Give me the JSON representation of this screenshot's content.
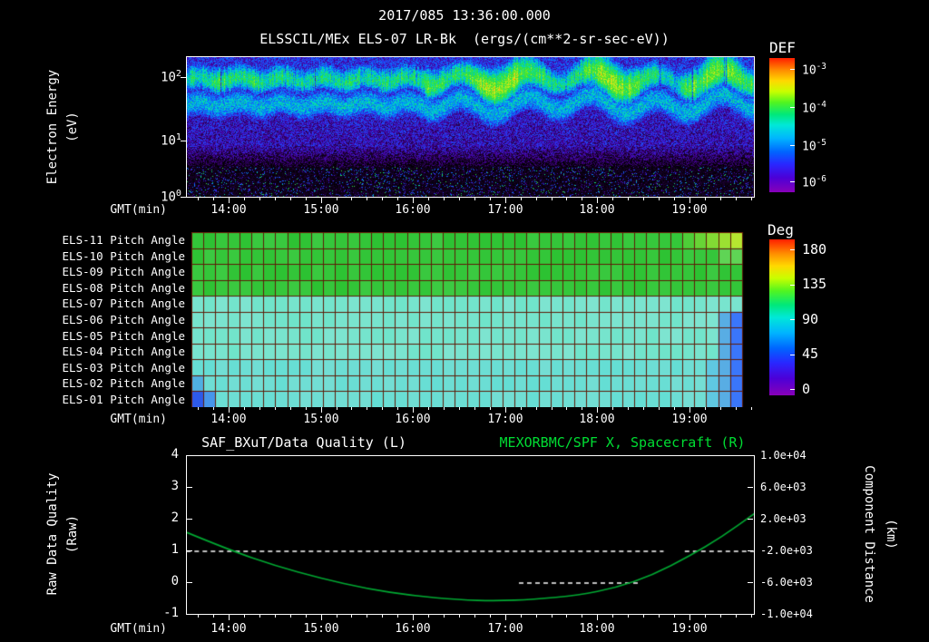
{
  "colors": {
    "background": "#000000",
    "text": "#ffffff",
    "frame": "#ffffff",
    "title_green": "#00dd33",
    "spacecraft_curve_green": "#00a832",
    "pitch_grid_red": "#5e1b08"
  },
  "header": {
    "timestamp": "2017/085 13:36:00.000",
    "title": "ELSSCIL/MEx ELS-07 LR-Bk",
    "units": "(ergs/(cm**2-sr-sec-eV))"
  },
  "axes": {
    "x_label": "GMT(min)",
    "x_ticks": [
      "14:00",
      "15:00",
      "16:00",
      "17:00",
      "18:00",
      "19:00"
    ],
    "pow_base": "10"
  },
  "spectrogram": {
    "ylabel_line1": "Electron Energy",
    "ylabel_line2": "(eV)",
    "ytick_exps": [
      "2",
      "1",
      "0"
    ],
    "colorbar_label": "DEF",
    "colorbar_tick_exps": [
      "-3",
      "-4",
      "-5",
      "-6"
    ]
  },
  "pitch": {
    "rows": [
      "ELS-11 Pitch Angle",
      "ELS-10 Pitch Angle",
      "ELS-09 Pitch Angle",
      "ELS-08 Pitch Angle",
      "ELS-07 Pitch Angle",
      "ELS-06 Pitch Angle",
      "ELS-05 Pitch Angle",
      "ELS-04 Pitch Angle",
      "ELS-03 Pitch Angle",
      "ELS-02 Pitch Angle",
      "ELS-01 Pitch Angle"
    ],
    "colorbar_label": "Deg",
    "colorbar_ticks": [
      "180",
      "135",
      "90",
      "45",
      "0"
    ]
  },
  "bottom": {
    "left_title": "SAF_BXuT/Data Quality (L)",
    "right_title": "MEXORBMC/SPF X, Spacecraft (R)",
    "left_ticks": [
      "4",
      "3",
      "2",
      "1",
      "0",
      "-1"
    ],
    "right_ticks": [
      "1.0e+04",
      "6.0e+03",
      "2.0e+03",
      "-2.0e+03",
      "-6.0e+03",
      "-1.0e+04"
    ],
    "left_label_line1": "Raw Data Quality",
    "left_label_line2": "(Raw)",
    "right_label_line1": "Component Distance",
    "right_label_line2": "(km)"
  },
  "chart_data": [
    {
      "type": "heatmap",
      "panel": "electron-energy-spectrogram",
      "title": "ELSSCIL/MEx ELS-07 LR-Bk",
      "units": "ergs/(cm**2-sr-sec-eV)",
      "xlabel": "GMT(min)",
      "x_ticks": [
        "14:00",
        "15:00",
        "16:00",
        "17:00",
        "18:00",
        "19:00"
      ],
      "x_range_hours_est": [
        13.54,
        19.71
      ],
      "ylabel": "Electron Energy (eV)",
      "y_scale": "log",
      "y_range_eV": [
        1,
        200
      ],
      "colorbar": {
        "label": "DEF",
        "scale": "log",
        "range": [
          1e-06,
          0.001
        ],
        "palette": [
          "#8800b8",
          "#2828ff",
          "#0064ff",
          "#00e8d8",
          "#52f520",
          "#c8ff00",
          "#ffd800",
          "#ff1e00"
        ]
      },
      "features": [
        {
          "band": "20-100 eV",
          "flux": "~1e-4",
          "appearance": "bright green band, wavy bursty yellow-green enhancements after ~16:00"
        },
        {
          "band": "3-15 eV",
          "flux": "~1e-5 to 1e-6",
          "appearance": "blue/purple speckled region"
        },
        {
          "band": "1-3 eV",
          "flux": "<1e-6",
          "appearance": "mostly black with sparse blue/green speckles"
        }
      ]
    },
    {
      "type": "heatmap",
      "panel": "pitch-angle-grid",
      "rows": [
        "ELS-11 Pitch Angle",
        "ELS-10 Pitch Angle",
        "ELS-09 Pitch Angle",
        "ELS-08 Pitch Angle",
        "ELS-07 Pitch Angle",
        "ELS-06 Pitch Angle",
        "ELS-05 Pitch Angle",
        "ELS-04 Pitch Angle",
        "ELS-03 Pitch Angle",
        "ELS-02 Pitch Angle",
        "ELS-01 Pitch Angle"
      ],
      "value_label": "Deg",
      "value_range": [
        0,
        180
      ],
      "x_ticks": [
        "14:00",
        "15:00",
        "16:00",
        "17:00",
        "18:00",
        "19:00"
      ],
      "row_mean_deg": [
        100,
        98,
        97,
        96,
        72,
        71,
        70,
        70,
        69,
        69,
        67
      ],
      "features": [
        {
          "where": "rows ELS-11..ELS-08",
          "value": "~95-100 deg (green)"
        },
        {
          "where": "rows ELS-07..ELS-01",
          "value": "~65-75 deg (cyan)"
        },
        {
          "where": "ELS-11 right end",
          "value": "~120-130 deg (yellow-green)"
        },
        {
          "where": "rows ELS-06..ELS-01 right end",
          "value": "~30-45 deg (blue)"
        },
        {
          "where": "ELS-01 leftmost cells",
          "value": "~30 deg (blue)"
        },
        {
          "where": "far right edge",
          "value": "no data (black column)"
        }
      ]
    },
    {
      "type": "line",
      "panel": "data-quality-and-spacecraft-x",
      "xlabel": "GMT(min)",
      "x_ticks": [
        "14:00",
        "15:00",
        "16:00",
        "17:00",
        "18:00",
        "19:00"
      ],
      "x_range_hours_est": [
        13.54,
        19.71
      ],
      "left_axis": {
        "label": "Raw Data Quality (Raw)",
        "range": [
          -1,
          4
        ]
      },
      "right_axis": {
        "label": "Component Distance (km)",
        "range": [
          -10000,
          10000
        ]
      },
      "series": [
        {
          "name": "SAF_BXuT/Data Quality (L)",
          "axis": "left",
          "style": "dashed",
          "color": "#ffffff",
          "segments": [
            {
              "value": 1,
              "t_start": 13.54,
              "t_end": 18.72
            },
            {
              "value": 0,
              "t_start": 17.15,
              "t_end": 18.45
            },
            {
              "value": 1,
              "t_start": 18.95,
              "t_end": 19.71
            }
          ]
        },
        {
          "name": "MEXORBMC/SPF X, Spacecraft (R)",
          "axis": "right",
          "style": "solid",
          "color": "#00a832",
          "points_km": [
            [
              13.54,
              400
            ],
            [
              14.0,
              -1800
            ],
            [
              14.5,
              -3800
            ],
            [
              15.0,
              -5400
            ],
            [
              15.5,
              -6720
            ],
            [
              16.0,
              -7600
            ],
            [
              16.5,
              -8120
            ],
            [
              16.9,
              -8240
            ],
            [
              17.3,
              -8080
            ],
            [
              17.8,
              -7520
            ],
            [
              18.2,
              -6600
            ],
            [
              18.6,
              -5000
            ],
            [
              19.0,
              -2600
            ],
            [
              19.35,
              -200
            ],
            [
              19.71,
              2800
            ]
          ]
        }
      ]
    }
  ]
}
